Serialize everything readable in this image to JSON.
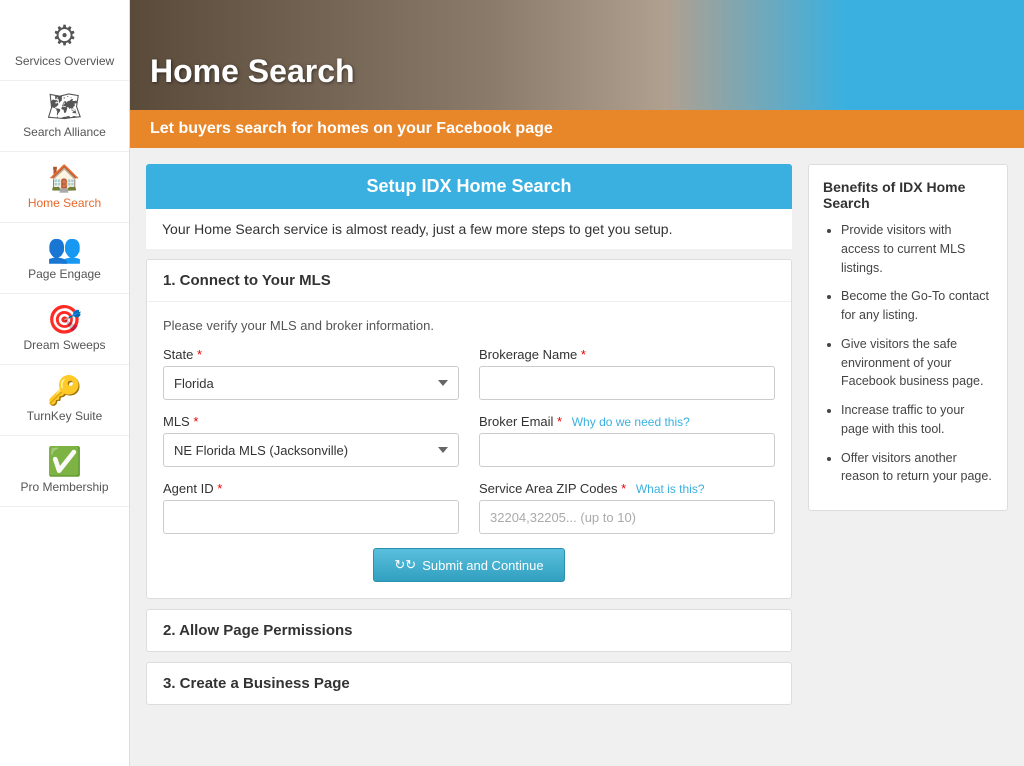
{
  "sidebar": {
    "items": [
      {
        "id": "services-overview",
        "label": "Services Overview",
        "icon": "gear",
        "active": false
      },
      {
        "id": "search-alliance",
        "label": "Search Alliance",
        "icon": "map",
        "active": false
      },
      {
        "id": "home-search",
        "label": "Home Search",
        "icon": "home",
        "active": true
      },
      {
        "id": "page-engage",
        "label": "Page Engage",
        "icon": "engage",
        "active": false
      },
      {
        "id": "dream-sweeps",
        "label": "Dream Sweeps",
        "icon": "sweeps",
        "active": false
      },
      {
        "id": "turnkey-suite",
        "label": "TurnKey Suite",
        "icon": "turnkey",
        "active": false
      },
      {
        "id": "pro-membership",
        "label": "Pro Membership",
        "icon": "pro",
        "active": false
      }
    ]
  },
  "hero": {
    "title": "Home Search",
    "subtitle": "Let buyers search for homes on your Facebook page"
  },
  "setup": {
    "header": "Setup IDX Home Search",
    "description": "Your Home Search service is almost ready, just a few more steps to get you setup.",
    "section1_title": "1. Connect to Your MLS",
    "form_hint": "Please verify your MLS and broker information.",
    "state_label": "State",
    "state_value": "Florida",
    "brokerage_label": "Brokerage Name",
    "mls_label": "MLS",
    "mls_value": "NE Florida MLS (Jacksonville)",
    "broker_email_label": "Broker Email",
    "broker_email_help": "Why do we need this?",
    "agent_id_label": "Agent ID",
    "service_area_label": "Service Area ZIP Codes",
    "service_area_help": "What is this?",
    "service_area_placeholder": "32204,32205... (up to 10)",
    "submit_label": "Submit and Continue",
    "section2_title": "2. Allow Page Permissions",
    "section3_title": "3. Create a Business Page"
  },
  "benefits": {
    "title": "Benefits of IDX Home Search",
    "items": [
      "Provide visitors with access to current MLS listings.",
      "Become the Go-To contact for any listing.",
      "Give visitors the safe environment of your Facebook business page.",
      "Increase traffic to your page with this tool.",
      "Offer visitors another reason to return your page."
    ]
  }
}
